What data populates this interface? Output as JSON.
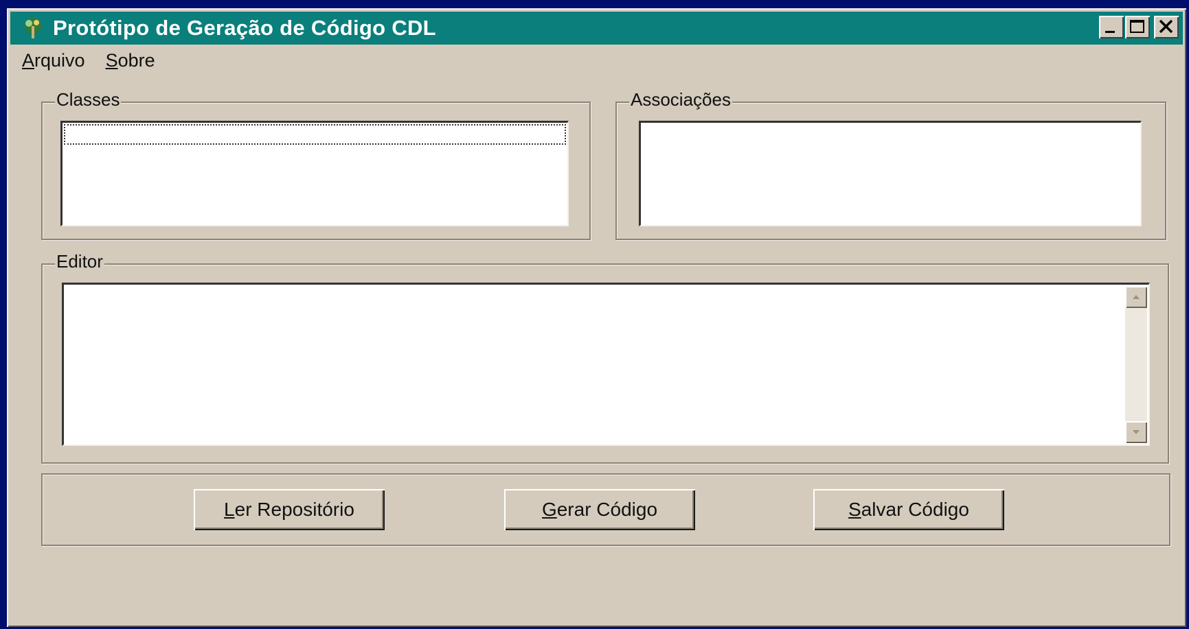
{
  "window": {
    "title": "Protótipo de Geração de Código CDL",
    "icon": "app-icon",
    "controls": {
      "minimize": "minimize-icon",
      "maximize": "maximize-icon",
      "close": "close-icon"
    }
  },
  "menu": {
    "items": [
      {
        "label_first": "A",
        "label_rest": "rquivo"
      },
      {
        "label_first": "S",
        "label_rest": "obre"
      }
    ]
  },
  "classes": {
    "label": "Classes",
    "items": []
  },
  "associacoes": {
    "label": "Associações",
    "items": []
  },
  "editor": {
    "label": "Editor",
    "value": ""
  },
  "buttons": {
    "ler": {
      "first": "L",
      "rest": "er Repositório"
    },
    "gerar": {
      "first": "G",
      "rest": "erar Código"
    },
    "salvar": {
      "first": "S",
      "rest": "alvar Código"
    }
  },
  "colors": {
    "desktop": "#000e6e",
    "titlebar": "#0a7f7c",
    "face": "#d4cbbd",
    "field": "#ffffff"
  }
}
